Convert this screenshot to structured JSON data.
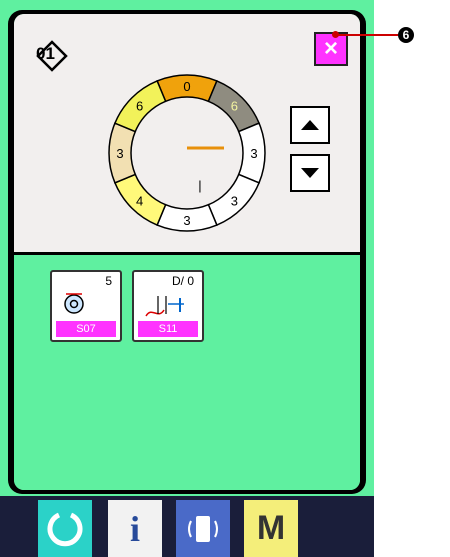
{
  "header": {
    "pattern_number": "01"
  },
  "close_button": {
    "label": "×"
  },
  "ring": {
    "segments": [
      "0",
      "6",
      "3",
      "3",
      "3",
      "4",
      "3",
      "6"
    ],
    "center_mark": "|"
  },
  "tiles": [
    {
      "id": "S07",
      "value": "5"
    },
    {
      "id": "S11",
      "value": "D/  0"
    }
  ],
  "bottom_bar": {
    "info_label": "i",
    "mode_label": "M"
  },
  "callout": {
    "number": "6"
  },
  "colors": {
    "screen_green": "#5ff0a0",
    "accent_magenta": "#ff33ff",
    "bar_dark": "#1a1e3a"
  }
}
